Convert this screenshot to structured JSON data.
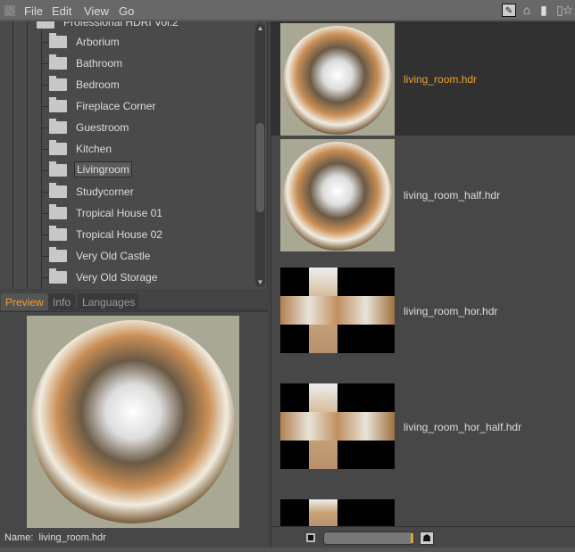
{
  "menubar": {
    "items": [
      "File",
      "Edit",
      "View",
      "Go"
    ],
    "icons": [
      "edit-icon",
      "home-icon",
      "jar-icon",
      "book-icon",
      "star-icon"
    ]
  },
  "tree": {
    "parent": "Professional HDRI Vol.2",
    "items": [
      "Arborium",
      "Bathroom",
      "Bedroom",
      "Fireplace Corner",
      "Guestroom",
      "Kitchen",
      "Livingroom",
      "Studycorner",
      "Tropical House 01",
      "Tropical House 02",
      "Very Old Castle",
      "Very Old Storage"
    ],
    "selected": "Livingroom"
  },
  "tabs": [
    {
      "label": "Preview",
      "active": true
    },
    {
      "label": "Info"
    },
    {
      "label": "Languages"
    }
  ],
  "preview": {
    "name_label": "Name:",
    "name_value": "living_room.hdr"
  },
  "files": [
    {
      "name": "living_room.hdr",
      "kind": "sphere",
      "selected": true
    },
    {
      "name": "living_room_half.hdr",
      "kind": "sphere"
    },
    {
      "name": "living_room_hor.hdr",
      "kind": "cross"
    },
    {
      "name": "living_room_hor_half.hdr",
      "kind": "cross"
    },
    {
      "name": "",
      "kind": "cross"
    }
  ],
  "colors": {
    "accent": "#f0a030",
    "background": "#474747"
  },
  "thumb_size_slider": {
    "value_percent": 100
  }
}
